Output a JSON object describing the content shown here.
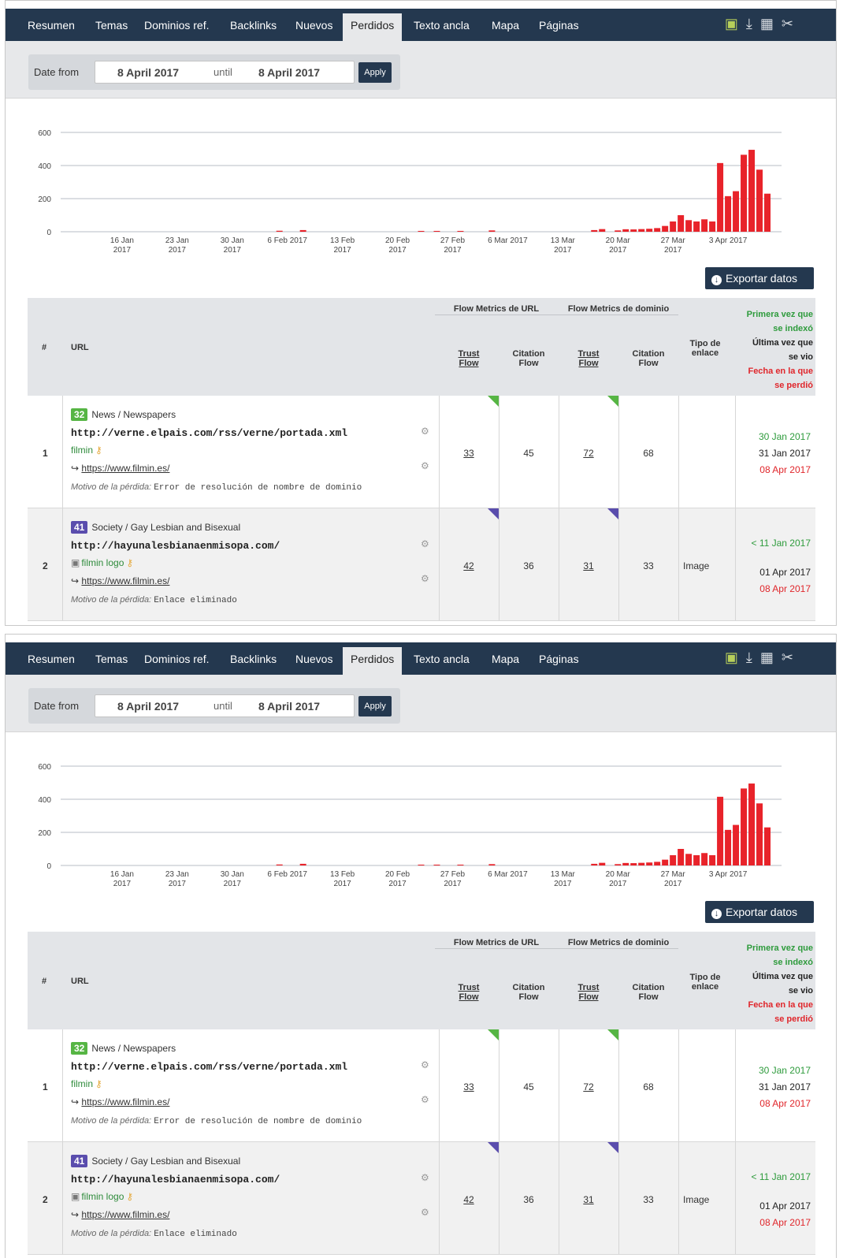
{
  "nav": {
    "tabs": [
      "Resumen",
      "Temas",
      "Dominios ref.",
      "Backlinks",
      "Nuevos",
      "Perdidos",
      "Texto ancla",
      "Mapa",
      "Páginas"
    ],
    "active": "Perdidos",
    "tools": [
      "report-icon",
      "download-icon",
      "calendar-icon",
      "settings-icon"
    ]
  },
  "datebar": {
    "label": "Date from",
    "from": "8 April 2017",
    "until_label": "until",
    "to": "8 April 2017",
    "apply": "Apply"
  },
  "chart_data": {
    "type": "bar",
    "y_ticks": [
      "0",
      "200",
      "400",
      "600"
    ],
    "ylim": [
      0,
      600
    ],
    "grid": true,
    "x_ticks": [
      {
        "l1": "16 Jan",
        "l2": "2017",
        "day": 7
      },
      {
        "l1": "23 Jan",
        "l2": "2017",
        "day": 14
      },
      {
        "l1": "30 Jan",
        "l2": "2017",
        "day": 21
      },
      {
        "l1": "6 Feb 2017",
        "l2": "",
        "day": 28
      },
      {
        "l1": "13 Feb",
        "l2": "2017",
        "day": 35
      },
      {
        "l1": "20 Feb",
        "l2": "2017",
        "day": 42
      },
      {
        "l1": "27 Feb",
        "l2": "2017",
        "day": 49
      },
      {
        "l1": "6 Mar 2017",
        "l2": "",
        "day": 56
      },
      {
        "l1": "13 Mar",
        "l2": "2017",
        "day": 63
      },
      {
        "l1": "20 Mar",
        "l2": "2017",
        "day": 70
      },
      {
        "l1": "27 Mar",
        "l2": "2017",
        "day": 77
      },
      {
        "l1": "3 Apr 2017",
        "l2": "",
        "day": 84
      }
    ],
    "bars": [
      {
        "day": 27,
        "value": 6
      },
      {
        "day": 30,
        "value": 10
      },
      {
        "day": 45,
        "value": 5
      },
      {
        "day": 47,
        "value": 5
      },
      {
        "day": 50,
        "value": 5
      },
      {
        "day": 54,
        "value": 8
      },
      {
        "day": 67,
        "value": 10
      },
      {
        "day": 68,
        "value": 16
      },
      {
        "day": 70,
        "value": 8
      },
      {
        "day": 71,
        "value": 15
      },
      {
        "day": 72,
        "value": 14
      },
      {
        "day": 73,
        "value": 16
      },
      {
        "day": 74,
        "value": 18
      },
      {
        "day": 75,
        "value": 22
      },
      {
        "day": 76,
        "value": 35
      },
      {
        "day": 77,
        "value": 62
      },
      {
        "day": 78,
        "value": 100
      },
      {
        "day": 79,
        "value": 70
      },
      {
        "day": 80,
        "value": 62
      },
      {
        "day": 81,
        "value": 75
      },
      {
        "day": 82,
        "value": 62
      },
      {
        "day": 83,
        "value": 415
      },
      {
        "day": 84,
        "value": 215
      },
      {
        "day": 85,
        "value": 245
      },
      {
        "day": 86,
        "value": 465
      },
      {
        "day": 87,
        "value": 495
      },
      {
        "day": 88,
        "value": 375
      },
      {
        "day": 89,
        "value": 230
      }
    ],
    "bar_color": "#e8232a",
    "grid_color": "#b7bdc4"
  },
  "export_label": "Exportar datos",
  "table": {
    "headers": {
      "num": "#",
      "url": "URL",
      "flow_url": "Flow Metrics de URL",
      "flow_domain": "Flow Metrics de dominio",
      "tf1": "Trust",
      "tf2": "Flow",
      "cf1": "Citation",
      "cf2": "Flow",
      "type1": "Tipo de",
      "type2": "enlace",
      "first1": "Primera vez que",
      "first2": "se indexó",
      "last1": "Última vez que",
      "last2": "se vio",
      "lost1": "Fecha en la que",
      "lost2": "se perdió"
    },
    "reason_label": "Motivo de la pérdida:",
    "rows": [
      {
        "num": "1",
        "topic_score": "32",
        "topic": "News / Newspapers",
        "url": "http://verne.elpais.com/rss/verne/portada.xml",
        "anchor": "filmin",
        "target": "https://www.filmin.es/",
        "reason": "Error de resolución de nombre de dominio",
        "url_tf": "33",
        "url_cf": "45",
        "dom_tf": "72",
        "dom_cf": "68",
        "link_type": "",
        "first_indexed": "30 Jan 2017",
        "last_seen": "31 Jan 2017",
        "lost_date": "08 Apr 2017"
      },
      {
        "num": "2",
        "topic_score": "41",
        "topic": "Society / Gay Lesbian and Bisexual",
        "url": "http://hayunalesbianaenmisopa.com/",
        "anchor": "filmin logo",
        "target": "https://www.filmin.es/",
        "reason": "Enlace eliminado",
        "url_tf": "42",
        "url_cf": "36",
        "dom_tf": "31",
        "dom_cf": "33",
        "link_type": "Image",
        "first_indexed": "< 11 Jan 2017",
        "last_seen": "01 Apr 2017",
        "lost_date": "08 Apr 2017"
      }
    ]
  }
}
